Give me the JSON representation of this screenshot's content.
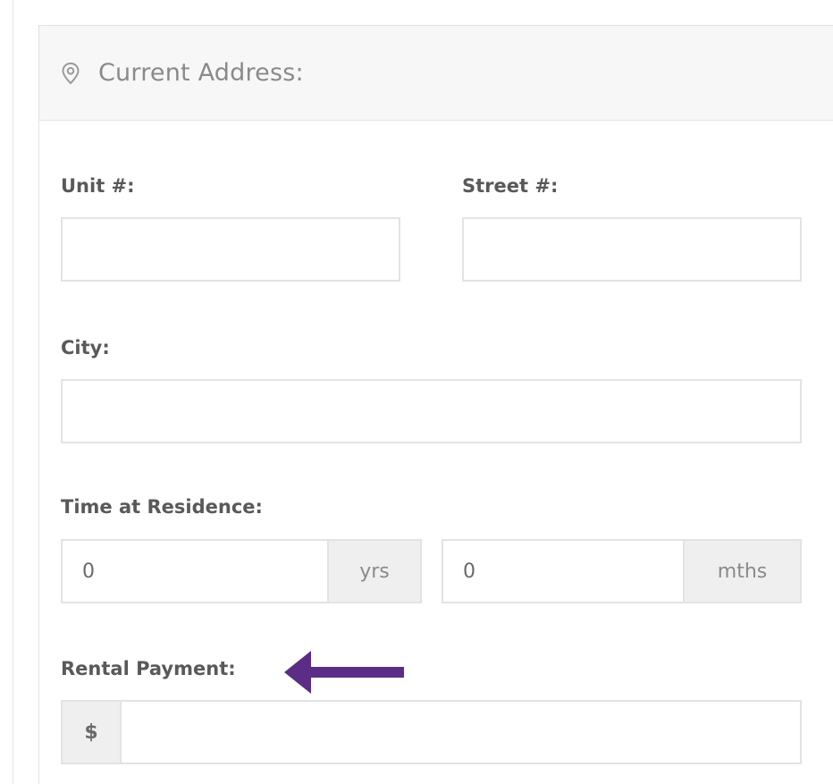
{
  "section": {
    "title": "Current Address:",
    "icon": "location-pin-icon"
  },
  "fields": {
    "unit": {
      "label": "Unit #:",
      "value": ""
    },
    "street": {
      "label": "Street #:",
      "value": ""
    },
    "city": {
      "label": "City:",
      "value": ""
    },
    "time_at_residence": {
      "label": "Time at Residence:",
      "years": {
        "value": "0",
        "unit": "yrs"
      },
      "months": {
        "value": "0",
        "unit": "mths"
      }
    },
    "rental_payment": {
      "label": "Rental Payment:",
      "prefix": "$",
      "value": ""
    }
  },
  "annotation": {
    "icon": "arrow-left-icon",
    "color": "#5b2d86"
  },
  "colors": {
    "border": "#e3e3e3",
    "header_bg": "#f7f7f7",
    "addon_bg": "#efefef"
  }
}
